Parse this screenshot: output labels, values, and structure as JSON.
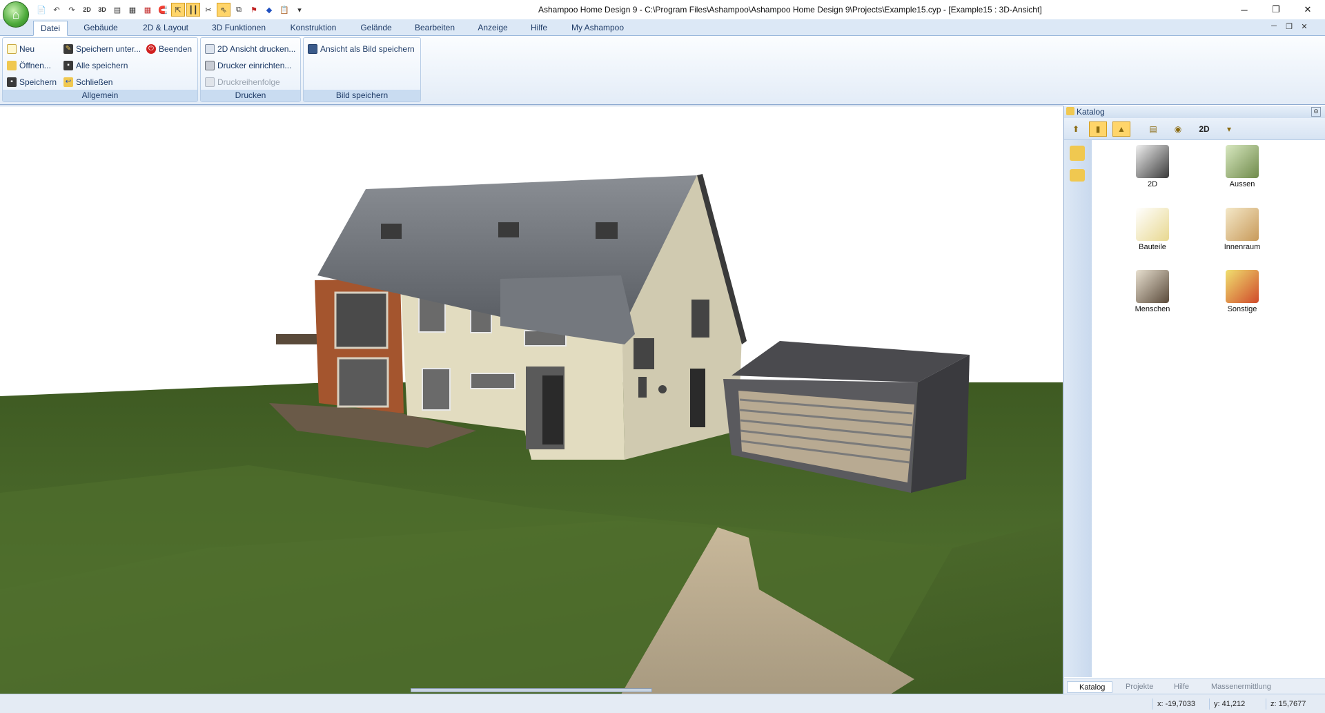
{
  "window": {
    "title": "Ashampoo Home Design 9 - C:\\Program Files\\Ashampoo\\Ashampoo Home Design 9\\Projects\\Example15.cyp - [Example15 : 3D-Ansicht]",
    "minimize_icon": "─",
    "restore_icon": "❐",
    "close_icon": "✕"
  },
  "qat": {
    "buttons": [
      "new-icon",
      "undo-icon",
      "redo-icon",
      "2d-icon",
      "3d-icon",
      "layout-icon",
      "table-icon",
      "grid-icon",
      "magnet-icon",
      "select-icon",
      "columns-icon",
      "scissor-icon",
      "pointer-icon",
      "copy-icon",
      "flag-icon",
      "eraser-icon",
      "paste-icon",
      "more-icon"
    ],
    "labels": [
      "📄",
      "↶",
      "↷",
      "2D",
      "3D",
      "▤",
      "▦",
      "▦",
      "🧲",
      "⇱",
      "┃┃",
      "✂",
      "⇖",
      "⧉",
      "⚑",
      "◆",
      "📋",
      "▾"
    ]
  },
  "tabs": [
    {
      "label": "Datei",
      "active": true
    },
    {
      "label": "Gebäude"
    },
    {
      "label": "2D & Layout"
    },
    {
      "label": "3D Funktionen"
    },
    {
      "label": "Konstruktion"
    },
    {
      "label": "Gelände"
    },
    {
      "label": "Bearbeiten"
    },
    {
      "label": "Anzeige"
    },
    {
      "label": "Hilfe"
    },
    {
      "label": "My Ashampoo"
    }
  ],
  "mdi_controls": {
    "minimize": "─",
    "restore": "❐",
    "close": "✕"
  },
  "ribbon": {
    "allgemein": {
      "label": "Allgemein",
      "neu": "Neu",
      "oeffnen": "Öffnen...",
      "speichern": "Speichern",
      "speichern_unter": "Speichern unter...",
      "alle_speichern": "Alle speichern",
      "schliessen": "Schließen",
      "beenden": "Beenden"
    },
    "drucken": {
      "label": "Drucken",
      "ansicht_drucken": "2D Ansicht drucken...",
      "drucker_einrichten": "Drucker einrichten...",
      "druckreihenfolge": "Druckreihenfolge"
    },
    "bild": {
      "label": "Bild speichern",
      "ansicht_als_bild": "Ansicht als Bild speichern"
    }
  },
  "catalog": {
    "title": "Katalog",
    "items": [
      {
        "label": "2D",
        "color": "#3a3a3a"
      },
      {
        "label": "Aussen",
        "color": "#6f8a4a"
      },
      {
        "label": "Bauteile",
        "color": "#e8e0c8"
      },
      {
        "label": "Innenraum",
        "color": "#c89a5a"
      },
      {
        "label": "Menschen",
        "color": "#5a4a3a"
      },
      {
        "label": "Sonstige",
        "color": "#d04a2a"
      }
    ],
    "tabs": [
      "Katalog",
      "Projekte",
      "Hilfe",
      "Massenermittlung"
    ]
  },
  "status": {
    "x": "x: -19,7033",
    "y": "y: 41,212",
    "z": "z: 15,7677"
  },
  "colors": {
    "accent": "#1d3a66",
    "grass": "#4a6a2a",
    "roof": "#6a6e74",
    "wall": "#e2dcc0",
    "brick": "#a4552e"
  }
}
